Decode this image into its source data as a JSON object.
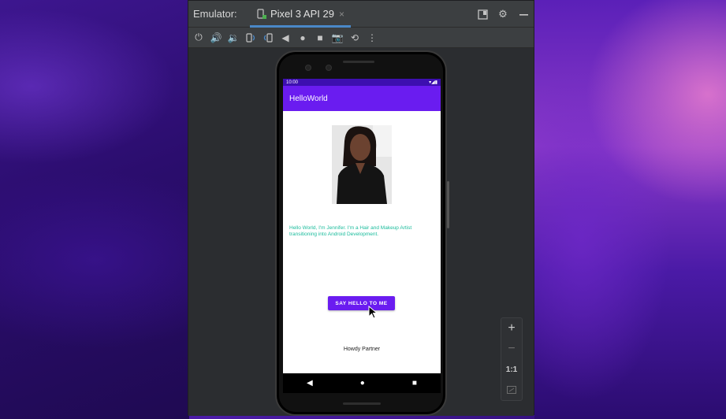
{
  "window": {
    "title": "Emulator:",
    "tab": {
      "label": "Pixel 3 API 29",
      "close_glyph": "×"
    }
  },
  "toolbar": {
    "icons": [
      "power-icon",
      "volume-up-icon",
      "volume-down-icon",
      "rotate-left-icon",
      "rotate-right-icon",
      "back-icon",
      "home-icon",
      "overview-icon",
      "camera-icon",
      "snapshot-icon",
      "more-icon"
    ]
  },
  "device": {
    "status_time": "10:00",
    "app_title": "HelloWorld",
    "bio_text": "Hello World, I'm Jennifer. I'm a Hair and Makeup Artist transitioning into Android Development.",
    "button_label": "SAY HELLO TO ME",
    "howdy_text": "Howdy Partner"
  },
  "zoom": {
    "plus": "+",
    "minus": "−",
    "one_to_one": "1:1"
  },
  "colors": {
    "accent": "#6a1cf0",
    "status": "#3d0fb0",
    "bio": "#1abc9c",
    "ide_bg": "#2b2d30",
    "tab_underline": "#4a88c7"
  }
}
